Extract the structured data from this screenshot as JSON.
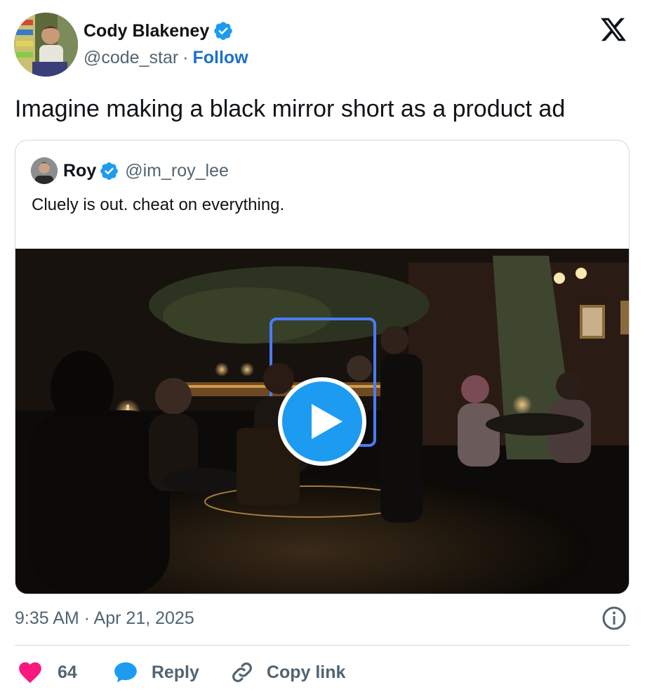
{
  "author": {
    "display_name": "Cody Blakeney",
    "handle": "@code_star",
    "separator": "·",
    "follow_label": "Follow"
  },
  "tweet": {
    "text": "Imagine making a black mirror short as a product ad",
    "timestamp": "9:35 AM · Apr 21, 2025"
  },
  "quoted": {
    "display_name": "Roy",
    "handle": "@im_roy_lee",
    "text": "Cluely is out. cheat on everything."
  },
  "actions": {
    "like_count": "64",
    "reply_label": "Reply",
    "copy_link_label": "Copy link"
  },
  "icons": {
    "verified": "verified-badge-icon",
    "logo": "x-logo-icon",
    "play": "play-icon",
    "info": "info-icon",
    "like": "heart-icon",
    "reply": "reply-bubble-icon",
    "copy": "link-icon"
  },
  "colors": {
    "accent": "#1d9bf0",
    "follow": "#1d6fd1",
    "like": "#f91880",
    "secondary_text": "#536471",
    "border": "#cfd9de"
  }
}
